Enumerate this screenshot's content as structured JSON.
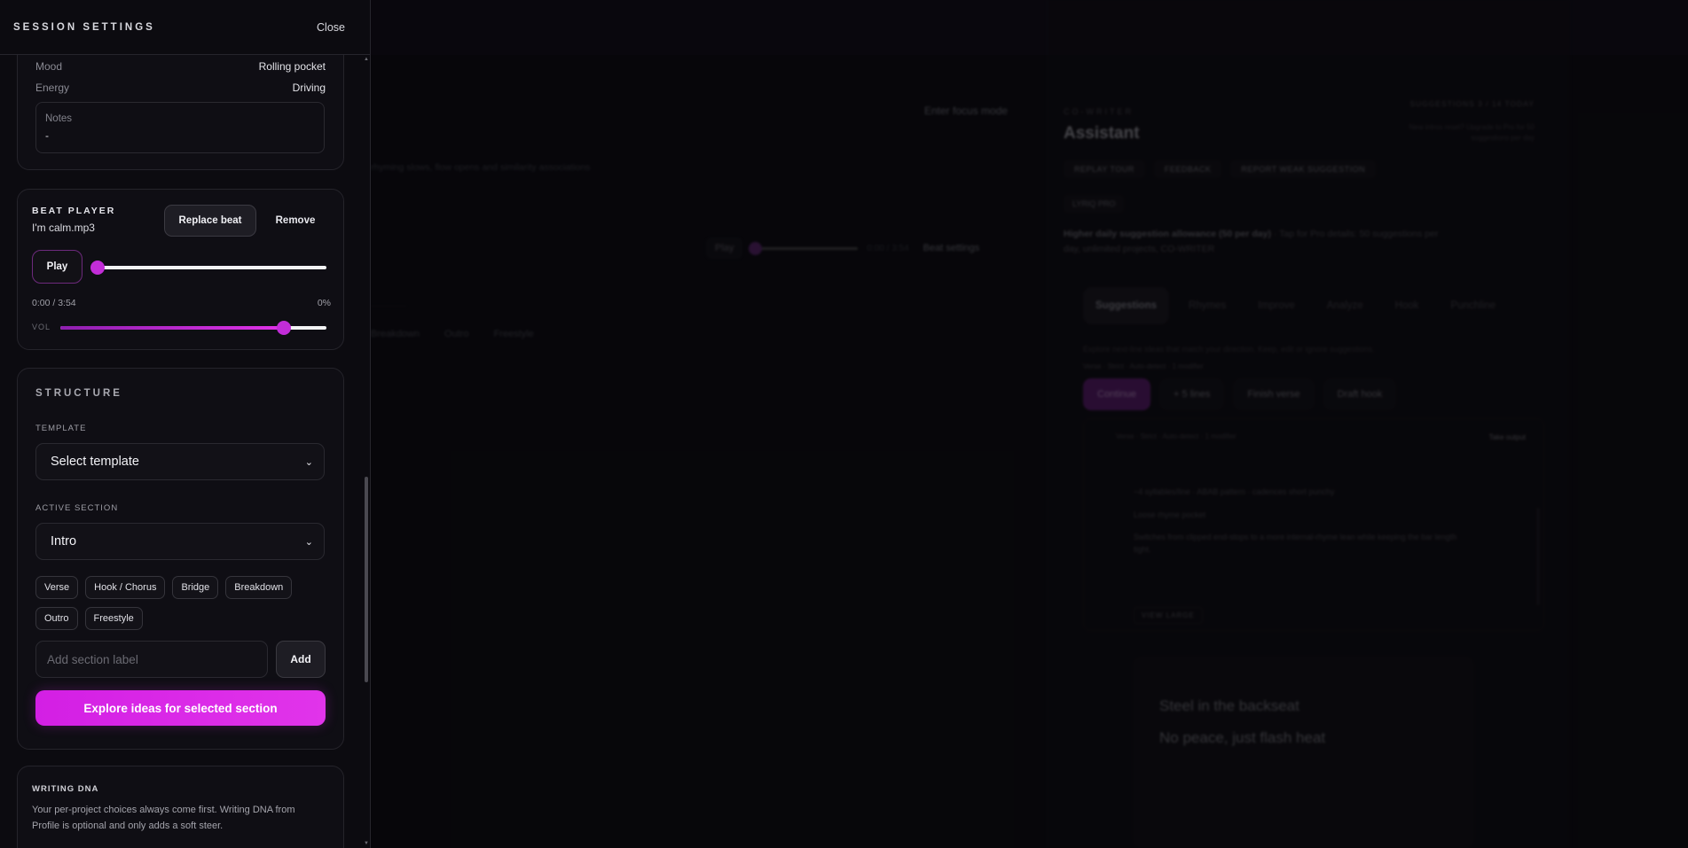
{
  "panel": {
    "title": "SESSION SETTINGS",
    "close_label": "Close",
    "mood_label": "Mood",
    "mood_value": "Rolling pocket",
    "energy_label": "Energy",
    "energy_value": "Driving",
    "notes_label": "Notes",
    "notes_value": "-"
  },
  "beat_player": {
    "label": "BEAT PLAYER",
    "file_name": "I'm calm.mp3",
    "replace_label": "Replace beat",
    "remove_label": "Remove",
    "play_label": "Play",
    "time": "0:00 / 3:54",
    "progress_pct_label": "0%",
    "progress": 0,
    "vol_label": "VOL",
    "volume": 0.84
  },
  "structure": {
    "title": "STRUCTURE",
    "template_label": "TEMPLATE",
    "template_value": "Select template",
    "active_section_label": "ACTIVE SECTION",
    "active_section_value": "Intro",
    "section_chips": [
      "Verse",
      "Hook / Chorus",
      "Bridge",
      "Breakdown",
      "Outro",
      "Freestyle"
    ],
    "add_placeholder": "Add section label",
    "add_label": "Add",
    "explore_label": "Explore ideas for selected section"
  },
  "writing_dna": {
    "title": "WRITING DNA",
    "text": "Your per-project choices always come first. Writing DNA from Profile is optional and only adds a soft steer."
  },
  "background": {
    "focus_mode": "Enter focus mode",
    "hint": "rhyming slows, flow opens and similarity associations",
    "play": "Play",
    "time": "0:00 / 3:54",
    "beat_settings": "Beat settings",
    "sections": [
      "Breakdown",
      "Outro",
      "Freestyle"
    ],
    "cowriter_label": "CO-WRITER",
    "assistant_title": "Assistant",
    "suggestions_meta": "SUGGESTIONS 3 / 14 TODAY",
    "meta_line1": "New intros reset? Upgrade to Pro for 50",
    "meta_line2": "suggestions per day",
    "chips": [
      "REPLAY TOUR",
      "FEEDBACK",
      "REPORT WEAK SUGGESTION"
    ],
    "pro_badge": "LYRIQ PRO",
    "desc_bold": "Higher daily suggestion allowance (50 per day)",
    "desc_rest": " · Tap for Pro details: 50 suggestions per day, unlimited projects, CO-WRITER",
    "tabs": [
      "Suggestions",
      "Rhymes",
      "Improve",
      "Analyze",
      "Hook",
      "Punchline"
    ],
    "sub_text": "Explore next-line ideas that match your direction. Keep, edit or ignore suggestions.",
    "sub_meta": "Verse · Strict · Auto-detect · 1 modifier",
    "actions": [
      "Continue",
      "+ 5 lines",
      "Finish verse",
      "Draft hook"
    ],
    "panel_meta": "Verse · Strict · Auto-detect · 1 modifier",
    "take_output": "Take output",
    "lines": [
      "~4 syllables/line · ABAB pattern · cadences short punchy",
      "Loose rhyme pocket",
      "Switches from clipped end-stops to a more internal-rhyme lean while keeping the bar length tight."
    ],
    "view_large": "VIEW LARGE",
    "lyrics": [
      "Steel in the backseat",
      "No peace, just flash heat"
    ]
  }
}
